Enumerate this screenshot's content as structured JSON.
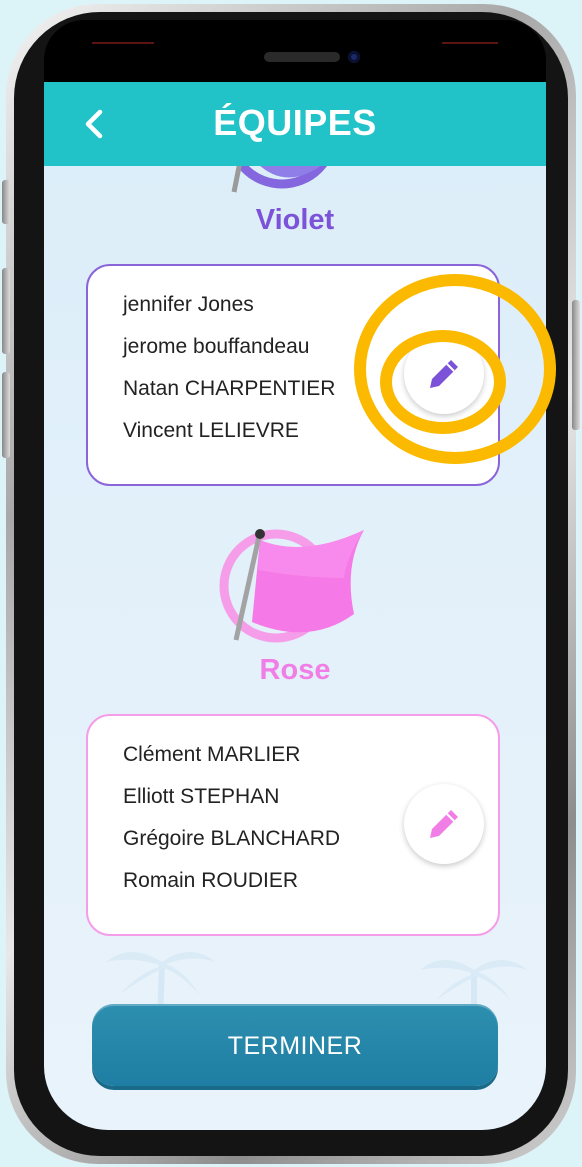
{
  "header": {
    "back_icon": "chevron-left-icon",
    "title": "ÉQUIPES"
  },
  "teams": [
    {
      "name": "Violet",
      "color": "#7b52d8",
      "border_color": "#8a65d9",
      "flag_icon": "flag-icon",
      "edit_icon": "pencil-icon",
      "members": [
        "jennifer Jones",
        "jerome bouffandeau",
        "Natan CHARPENTIER",
        "Vincent LELIEVRE"
      ]
    },
    {
      "name": "Rose",
      "color": "#f07ee6",
      "border_color": "#f59de9",
      "flag_icon": "flag-icon",
      "edit_icon": "pencil-icon",
      "members": [
        "Clément MARLIER",
        "Elliott STEPHAN",
        "Grégoire BLANCHARD",
        "Romain ROUDIER"
      ]
    }
  ],
  "finish_button": {
    "label": "TERMINER"
  },
  "colors": {
    "header": "#22c2c9",
    "button": "#1f7ea3",
    "highlight": "#fbba00"
  }
}
